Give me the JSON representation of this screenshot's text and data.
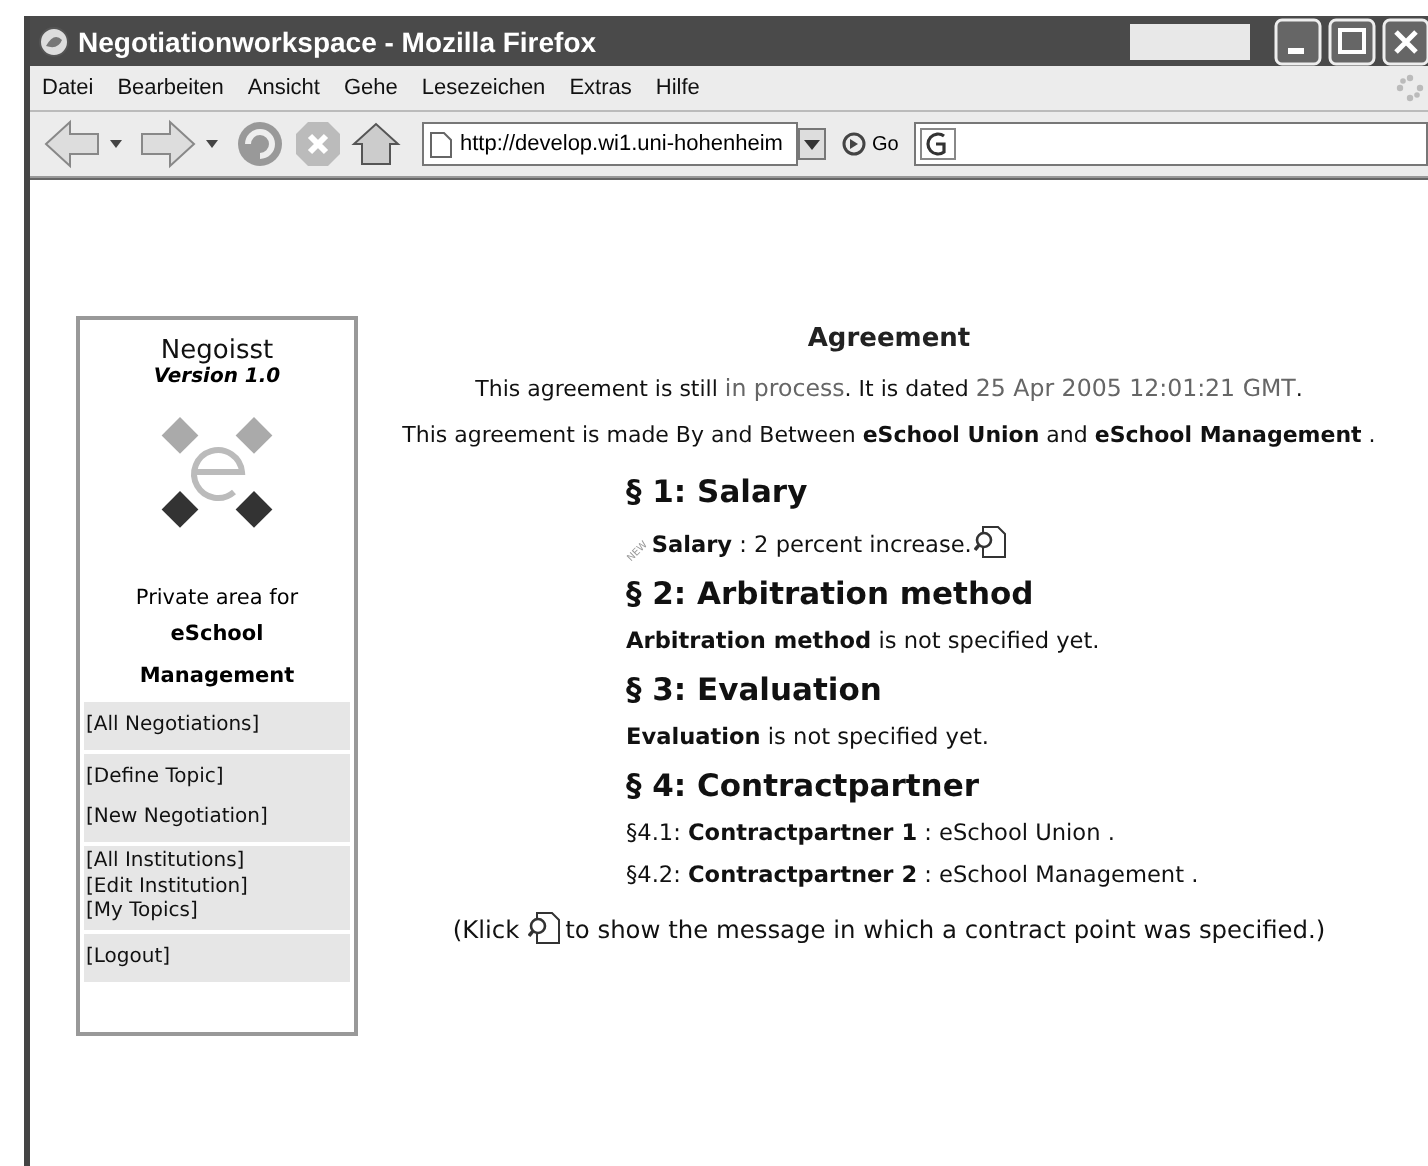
{
  "window": {
    "title": "Negotiationworkspace - Mozilla Firefox"
  },
  "menu": [
    "Datei",
    "Bearbeiten",
    "Ansicht",
    "Gehe",
    "Lesezeichen",
    "Extras",
    "Hilfe"
  ],
  "toolbar": {
    "address": "http://develop.wi1.uni-hohenheim",
    "go": "Go"
  },
  "sidebar": {
    "title": "Negoisst",
    "version": "Version 1.0",
    "area_label": "Private area for",
    "area_owner": "eSchool Management",
    "groups": [
      [
        "[All Negotiations]"
      ],
      [
        "[Define Topic]",
        "[New Negotiation]"
      ],
      [
        "[All Institutions]",
        "[Edit Institution]",
        "[My Topics]"
      ],
      [
        "[Logout]"
      ]
    ]
  },
  "agreement": {
    "title": "Agreement",
    "status": [
      {
        "kind": "plain",
        "text": "This agreement is still "
      },
      {
        "kind": "value",
        "text": "in process"
      },
      {
        "kind": "plain",
        "text": ". It is dated "
      },
      {
        "kind": "value",
        "text": "25 Apr 2005 12:01:21 GMT"
      },
      {
        "kind": "plain",
        "text": "."
      }
    ],
    "parties": "This agreement is made By and Between **eSchool Union** and **eSchool Management** .",
    "sections": [
      {
        "heading": "§ 1: Salary",
        "lines": [
          {
            "text": "**Salary** : 2 percent increase.",
            "badge": "NEW",
            "message_link": true
          }
        ]
      },
      {
        "heading": "§ 2: Arbitration method",
        "lines": [
          {
            "text": "**Arbitration method** is not specified yet.",
            "message_link": false
          }
        ]
      },
      {
        "heading": "§ 3: Evaluation",
        "lines": [
          {
            "text": "**Evaluation** is not specified yet.",
            "message_link": false
          }
        ]
      },
      {
        "heading": "§ 4: Contractpartner",
        "lines": [
          {
            "text": "§4.1: **Contractpartner 1** : eSchool Union .",
            "message_link": false
          },
          {
            "text": "§4.2: **Contractpartner 2** : eSchool Management .",
            "message_link": false
          }
        ]
      }
    ],
    "hint_before": "(Klick",
    "hint_after": "to show the message in which a contract point was specified.)"
  }
}
